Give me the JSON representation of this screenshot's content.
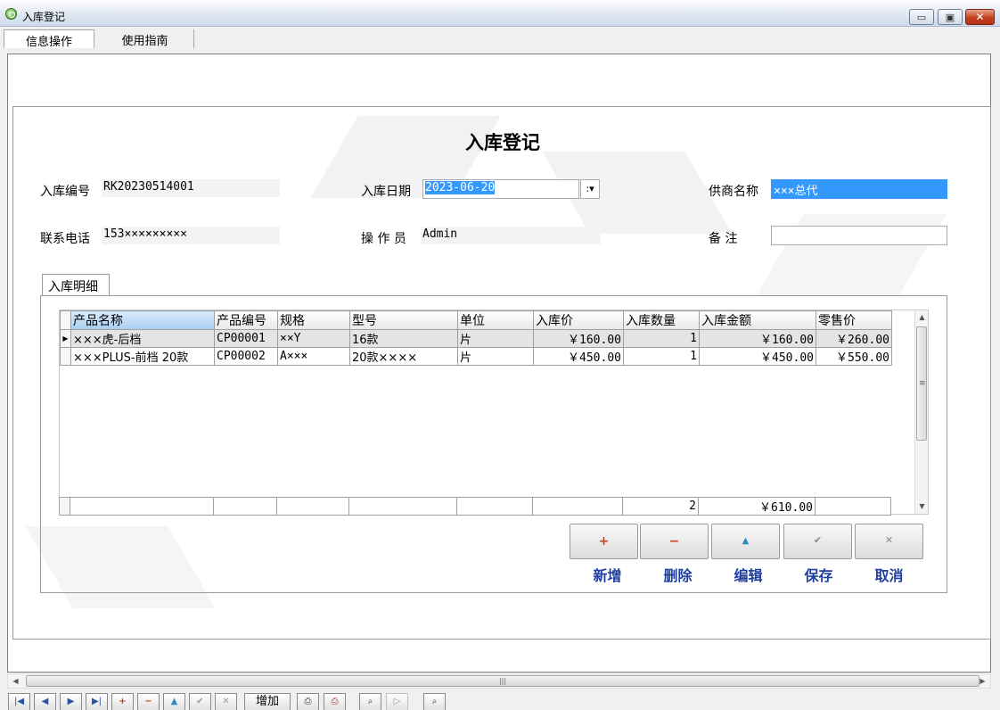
{
  "window": {
    "title": "入库登记",
    "icon": "search-app-icon"
  },
  "tabs": [
    {
      "label": "信息操作",
      "active": true
    },
    {
      "label": "使用指南",
      "active": false
    }
  ],
  "form": {
    "title": "入库登记",
    "fields": {
      "inbound_no_label": "入库编号",
      "inbound_no_value": "RK20230514001",
      "date_label": "入库日期",
      "date_value": "2023-06-20",
      "supplier_label": "供商名称",
      "supplier_value": "×××总代",
      "phone_label": "联系电话",
      "phone_value": "153×××××××××",
      "operator_label": "操 作 员",
      "operator_value": "Admin",
      "remark_label": "备    注",
      "remark_value": ""
    }
  },
  "detail_tab": {
    "label": "入库明细"
  },
  "grid": {
    "columns": [
      "产品名称",
      "产品编号",
      "规格",
      "型号",
      "单位",
      "入库价",
      "入库数量",
      "入库金额",
      "零售价"
    ],
    "rows": [
      {
        "name": "×××虎-后档",
        "code": "CP00001",
        "spec": "××Y",
        "model": "16款",
        "unit": "片",
        "price": "￥160.00",
        "qty": "1",
        "amount": "￥160.00",
        "retail": "￥260.00"
      },
      {
        "name": "×××PLUS-前档 20款",
        "code": "CP00002",
        "spec": "A×××",
        "model": "20款××××",
        "unit": "片",
        "price": "￥450.00",
        "qty": "1",
        "amount": "￥450.00",
        "retail": "￥550.00"
      }
    ],
    "totals": {
      "qty": "2",
      "amount": "￥610.00"
    }
  },
  "actions": [
    {
      "label": "新增",
      "icon": "plus-icon",
      "symbol": "+",
      "color": "#d0401a"
    },
    {
      "label": "删除",
      "icon": "minus-icon",
      "symbol": "−",
      "color": "#d0401a"
    },
    {
      "label": "编辑",
      "icon": "triangle-up-icon",
      "symbol": "▲",
      "color": "#2e8bc0"
    },
    {
      "label": "保存",
      "icon": "check-icon",
      "symbol": "✔",
      "color": "#8a8a8a"
    },
    {
      "label": "取消",
      "icon": "x-icon",
      "symbol": "✕",
      "color": "#8a8a8a"
    }
  ],
  "toolbar": {
    "add_label": "增加"
  },
  "colors": {
    "action_label": "#1f3f9e",
    "selection": "#3399ff"
  }
}
